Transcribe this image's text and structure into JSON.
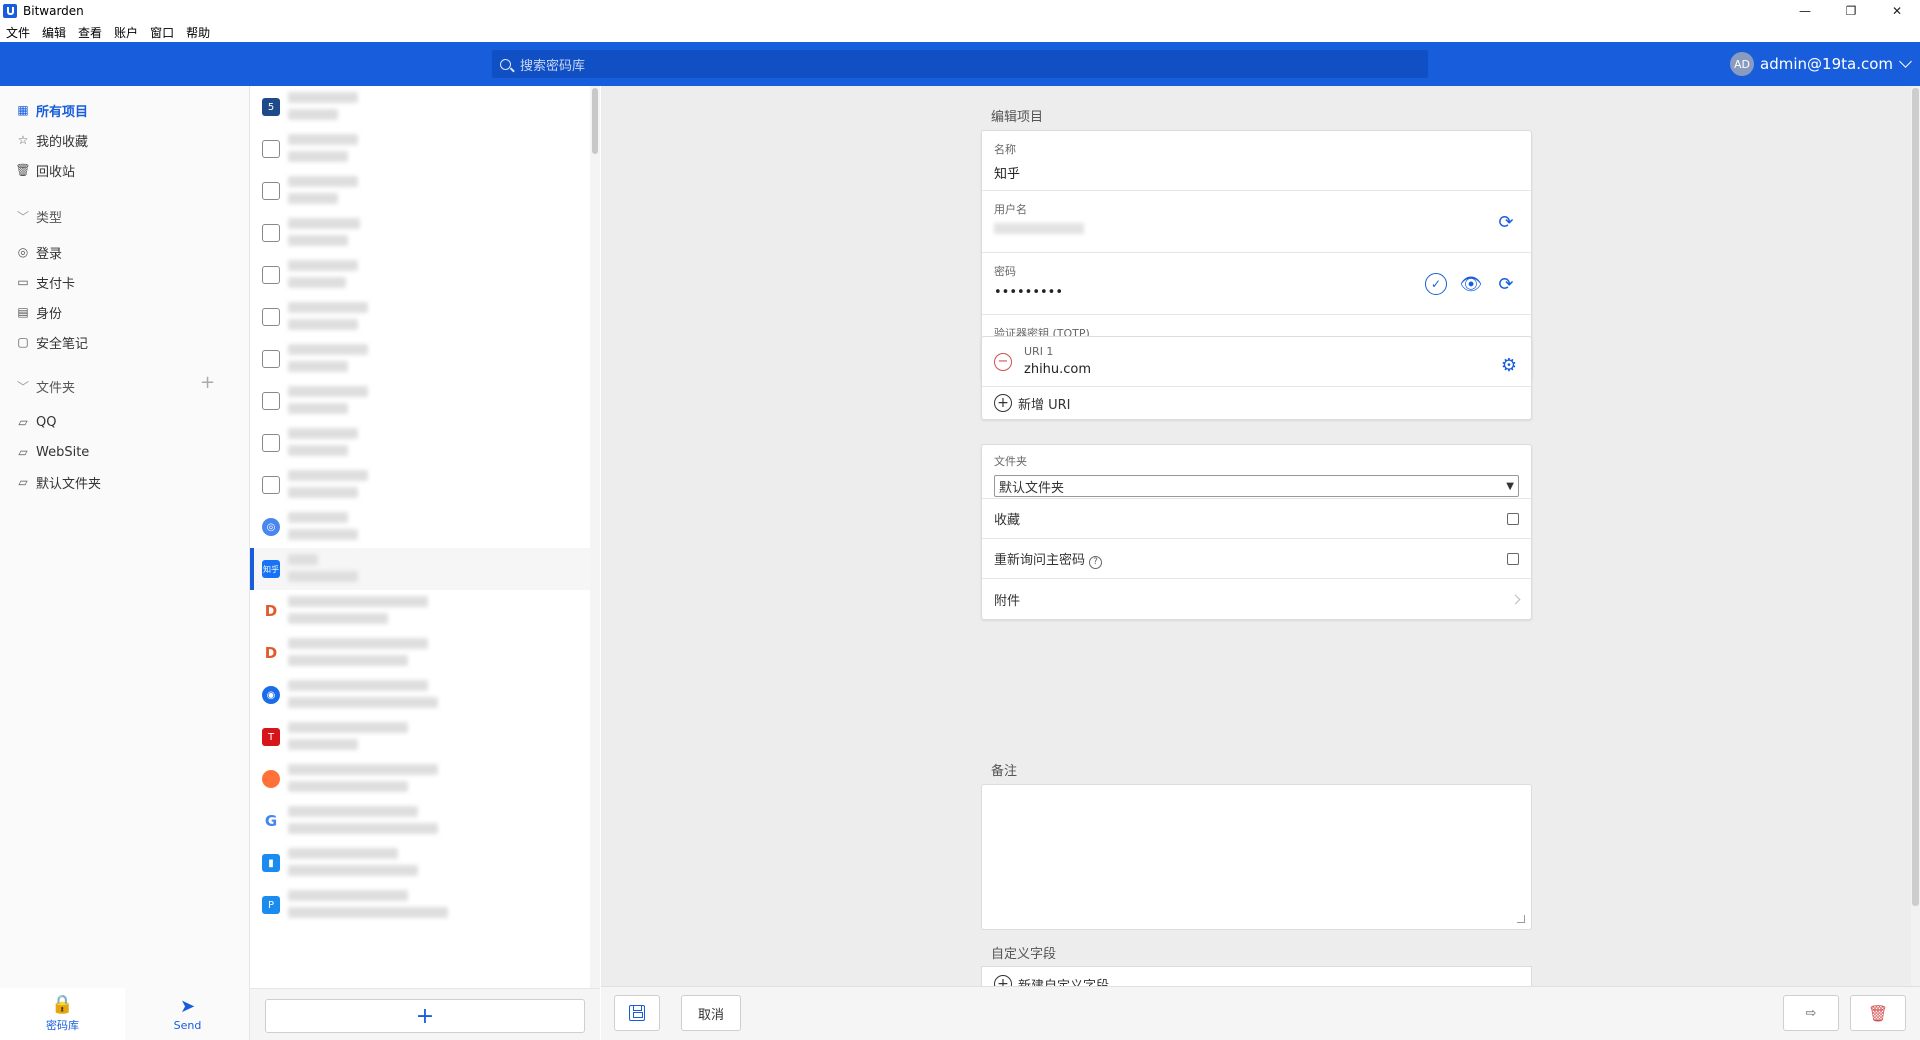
{
  "window": {
    "title": "Bitwarden",
    "controls": {
      "minimize": "—",
      "restore": "❐",
      "close": "✕"
    }
  },
  "menu": [
    "文件",
    "编辑",
    "查看",
    "账户",
    "窗口",
    "帮助"
  ],
  "header": {
    "search_placeholder": "搜索密码库",
    "avatar_initials": "AD",
    "account_email": "admin@19ta.com"
  },
  "sidebar": {
    "all_items": "所有项目",
    "favorites": "我的收藏",
    "trash": "回收站",
    "types_header": "类型",
    "types": [
      "登录",
      "支付卡",
      "身份",
      "安全笔记"
    ],
    "folders_header": "文件夹",
    "folders": [
      "QQ",
      "WebSite",
      "默认文件夹"
    ],
    "bottom_nav": {
      "vault": "密码库",
      "send": "Send"
    }
  },
  "list": {
    "selected_icon_text": "知乎",
    "add_icon": "+"
  },
  "editor": {
    "section_title": "编辑项目",
    "name_label": "名称",
    "name_value": "知乎",
    "username_label": "用户名",
    "password_label": "密码",
    "password_value": "•••••••••",
    "totp_label": "验证器密钥 (TOTP)",
    "uri_label": "URI 1",
    "uri_value": "zhihu.com",
    "new_uri": "新增 URI",
    "folder_label": "文件夹",
    "folder_value": "默认文件夹",
    "favorite_label": "收藏",
    "reprompt_label": "重新询问主密码",
    "attachments_label": "附件",
    "notes_label": "备注",
    "custom_fields_label": "自定义字段",
    "new_custom_field": "新建自定义字段"
  },
  "footer": {
    "cancel": "取消"
  },
  "colors": {
    "brand": "#175ddc",
    "danger": "#d34f4f"
  }
}
